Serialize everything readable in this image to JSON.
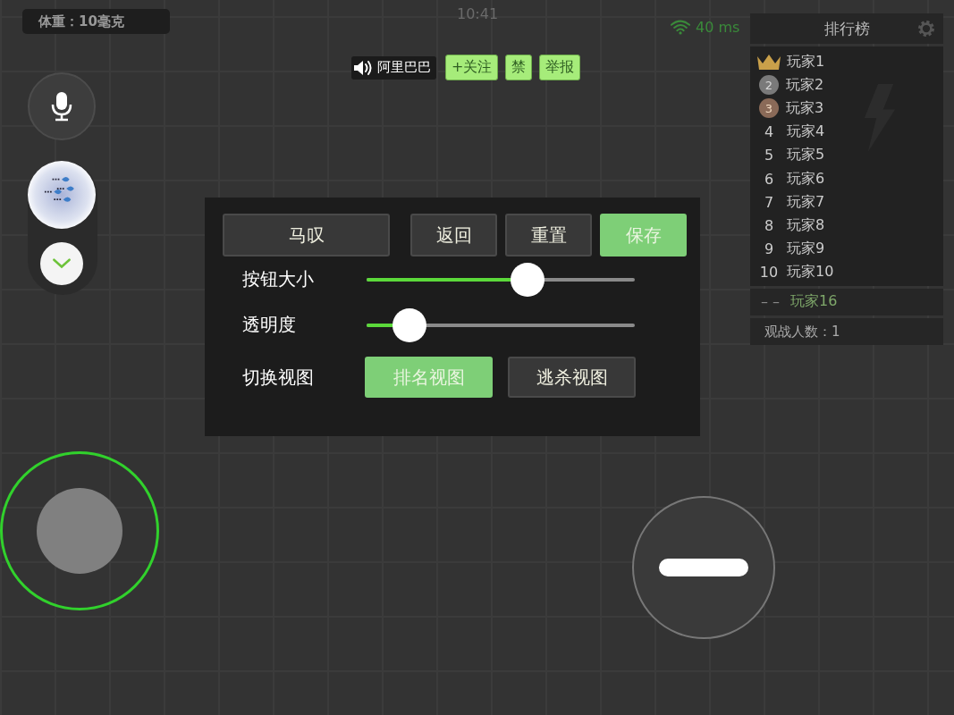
{
  "weight": "体重：10毫克",
  "time": "10:41",
  "ping": "40 ms",
  "voice_bar": {
    "name": "阿里巴巴",
    "buttons": [
      "+关注",
      "禁",
      "举报"
    ]
  },
  "leaderboard": {
    "title": "排行榜",
    "entries": [
      {
        "kind": "crown",
        "player": "玩家1"
      },
      {
        "kind": "silver",
        "rank": "2",
        "player": "玩家2"
      },
      {
        "kind": "bronze",
        "rank": "3",
        "player": "玩家3"
      },
      {
        "kind": "plain",
        "rank": "4",
        "player": "玩家4"
      },
      {
        "kind": "plain",
        "rank": "5",
        "player": "玩家5"
      },
      {
        "kind": "plain",
        "rank": "6",
        "player": "玩家6"
      },
      {
        "kind": "plain",
        "rank": "7",
        "player": "玩家7"
      },
      {
        "kind": "plain",
        "rank": "8",
        "player": "玩家8"
      },
      {
        "kind": "plain",
        "rank": "9",
        "player": "玩家9"
      },
      {
        "kind": "plain",
        "rank": "10",
        "player": "玩家10"
      }
    ],
    "self": {
      "rank": "– –",
      "player": "玩家16"
    },
    "spectators": "观战人数：1"
  },
  "settings": {
    "name": "马叹",
    "actions": [
      {
        "label": "返回",
        "kind": "normal"
      },
      {
        "label": "重置",
        "kind": "normal"
      },
      {
        "label": "保存",
        "kind": "primary"
      }
    ],
    "sliders": [
      {
        "label": "按钮大小",
        "level": 0.6
      },
      {
        "label": "透明度",
        "level": 0.16
      }
    ],
    "view_label": "切换视图",
    "views": [
      {
        "label": "排名视图",
        "selected": true
      },
      {
        "label": "逃杀视图",
        "selected": false
      }
    ]
  }
}
